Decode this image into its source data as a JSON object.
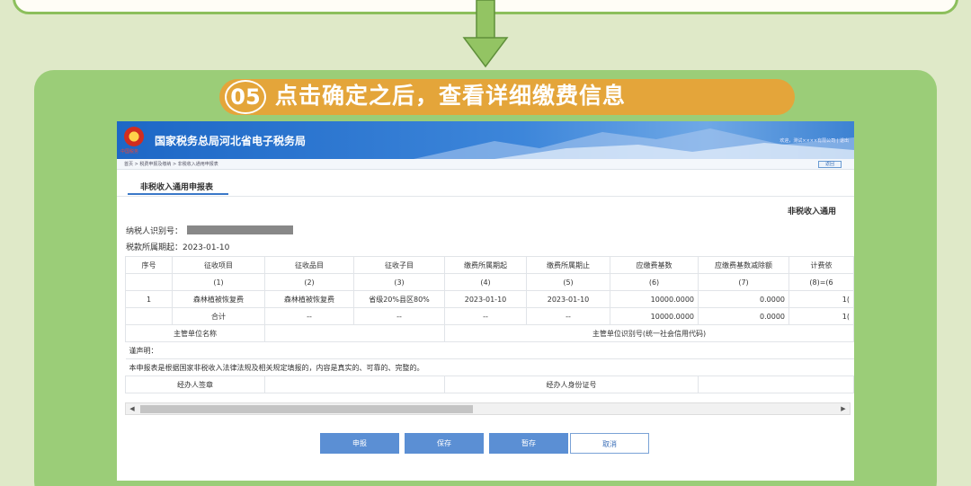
{
  "step": {
    "number": "05",
    "title": "点击确定之后，查看详细缴费信息"
  },
  "site": {
    "title": "国家税务总局河北省电子税务局",
    "emblem_caption": "中国税务",
    "welcome": "欢迎，测试××××有限公司 | 退出"
  },
  "breadcrumb": {
    "home": "首页",
    "level1": "税费申报及缴纳",
    "current": "非税收入通用申报表",
    "back": "返回"
  },
  "tab": {
    "label": "非税收入通用申报表"
  },
  "form": {
    "heading": "非税收入通用",
    "taxpayer_id_label": "纳税人识别号：",
    "period_label": "税款所属期起：2023-01-10"
  },
  "table": {
    "headers": [
      "序号",
      "征收项目",
      "征收品目",
      "征收子目",
      "缴费所属期起",
      "缴费所属期止",
      "应缴费基数",
      "应缴费基数减除额",
      "计费依"
    ],
    "numbers": [
      "",
      "(1)",
      "(2)",
      "(3)",
      "(4)",
      "(5)",
      "(6)",
      "(7)",
      "(8)=(6"
    ],
    "row1": [
      "1",
      "森林植被恢复费",
      "森林植被恢复费",
      "省级20%县区80%",
      "2023-01-10",
      "2023-01-10",
      "10000.0000",
      "0.0000",
      "1("
    ],
    "total": [
      "",
      "合计",
      "--",
      "--",
      "--",
      "--",
      "10000.0000",
      "0.0000",
      "1("
    ],
    "authority_label": "主管单位名称",
    "authority_code_label": "主管单位识别号(统一社会信用代码)",
    "declaration_title": "谨声明：",
    "declaration_text": "本申报表是根据国家非税收入法律法规及相关规定填报的，内容是真实的、可靠的、完整的。",
    "agent_signature_label": "经办人签章",
    "agent_id_label": "经办人身份证号"
  },
  "buttons": {
    "declare": "申报",
    "save": "保存",
    "temp_save": "暂存",
    "cancel": "取消"
  },
  "colors": {
    "panel": "#9bcd78",
    "banner": "#e4a53a",
    "header": "#1d67c6",
    "button": "#5b8fd4"
  }
}
